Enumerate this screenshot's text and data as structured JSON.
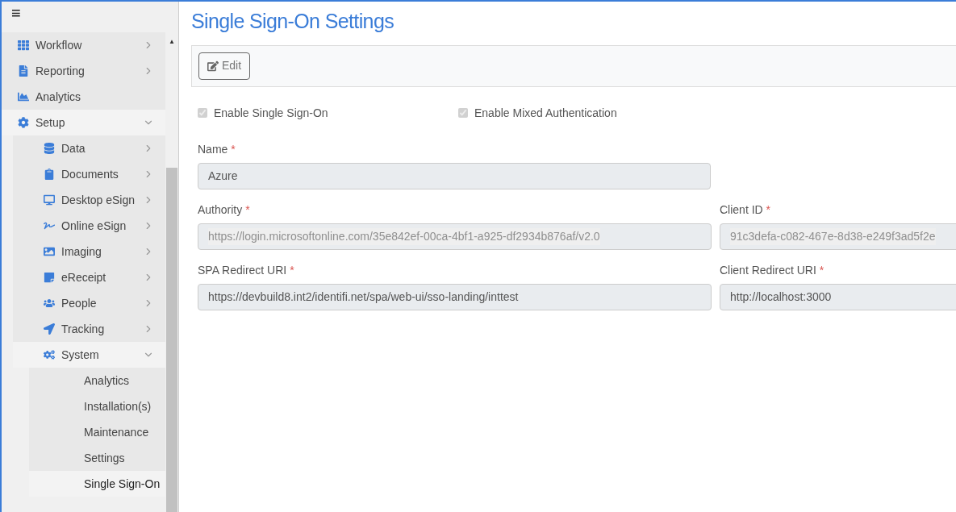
{
  "sidebar": {
    "menu_icon": "≡",
    "scroll_up": "▲",
    "items": [
      {
        "label": "Workflow",
        "expanded": false,
        "selected": false
      },
      {
        "label": "Reporting",
        "expanded": false,
        "selected": false
      },
      {
        "label": "Analytics",
        "selected": false
      },
      {
        "label": "Setup",
        "expanded": true,
        "selected": false,
        "children": [
          {
            "label": "Data",
            "expanded": false,
            "selected": false
          },
          {
            "label": "Documents",
            "expanded": false,
            "selected": false
          },
          {
            "label": "Desktop eSign",
            "expanded": false,
            "selected": false
          },
          {
            "label": "Online eSign",
            "expanded": false,
            "selected": false
          },
          {
            "label": "Imaging",
            "expanded": false,
            "selected": false
          },
          {
            "label": "eReceipt",
            "expanded": false,
            "selected": false
          },
          {
            "label": "People",
            "expanded": false,
            "selected": false
          },
          {
            "label": "Tracking",
            "expanded": false,
            "selected": false
          },
          {
            "label": "System",
            "expanded": true,
            "selected": false,
            "children": [
              {
                "label": "Analytics",
                "selected": false
              },
              {
                "label": "Installation(s)",
                "selected": false
              },
              {
                "label": "Maintenance",
                "selected": false
              },
              {
                "label": "Settings",
                "selected": false
              },
              {
                "label": "Single Sign-On",
                "selected": true
              }
            ]
          }
        ]
      }
    ]
  },
  "page": {
    "title": "Single Sign-On Settings",
    "toolbar": {
      "edit_button": "Edit"
    },
    "checkboxes": [
      {
        "label": "Enable Single Sign-On",
        "checked": true,
        "disabled": true
      },
      {
        "label": "Enable Mixed Authentication",
        "checked": true,
        "disabled": true
      }
    ],
    "fields": [
      {
        "label": "Name",
        "required_mark": "*",
        "value": "Azure",
        "faded": false
      },
      {
        "label": "Authority",
        "required_mark": "*",
        "value": "https://login.microsoftonline.com/35e842ef-00ca-4bf1-a925-df2934b876af/v2.0",
        "faded": true
      },
      {
        "label": "Client ID",
        "required_mark": "*",
        "value": "91c3defa-c082-467e-8d38-e249f3ad5f2e",
        "faded": true
      },
      {
        "label": "SPA Redirect URI",
        "required_mark": "*",
        "value": "https://devbuild8.int2/identifi.net/spa/web-ui/sso-landing/inttest",
        "faded": false
      },
      {
        "label": "Client Redirect URI",
        "required_mark": "*",
        "value": "http://localhost:3000",
        "faded": false
      }
    ]
  }
}
